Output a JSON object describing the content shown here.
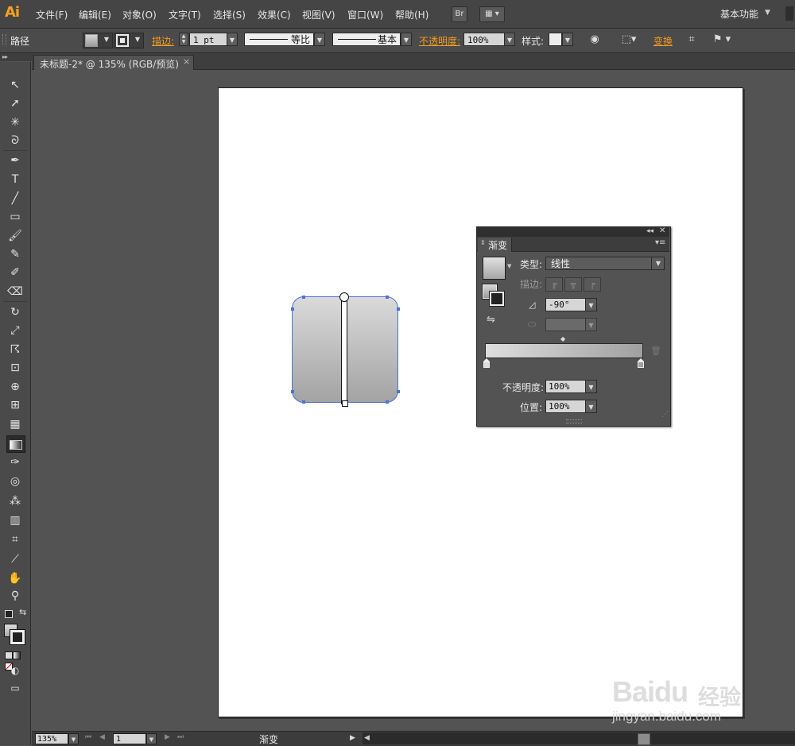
{
  "app": {
    "logo": "Ai"
  },
  "menu": [
    "文件(F)",
    "编辑(E)",
    "对象(O)",
    "文字(T)",
    "选择(S)",
    "效果(C)",
    "视图(V)",
    "窗口(W)",
    "帮助(H)"
  ],
  "menubar_right": {
    "bridge_label": "Br",
    "workspace": "基本功能"
  },
  "control": {
    "object_type": "路径",
    "stroke_link": "描边:",
    "stroke_weight": "1 pt",
    "profile_label": "等比",
    "brush_label": "基本",
    "opacity_link": "不透明度:",
    "opacity_value": "100%",
    "style_label": "样式:",
    "transform_link": "变换"
  },
  "document": {
    "tab_title": "未标题-2* @ 135% (RGB/预览)",
    "close_glyph": "×"
  },
  "gradient_panel": {
    "tab_label": "渐变",
    "type_label": "类型:",
    "type_value": "线性",
    "stroke_label": "描边:",
    "angle_value": "-90°",
    "opacity_label": "不透明度:",
    "opacity_value": "100%",
    "location_label": "位置:",
    "location_value": "100%",
    "colors": {
      "stop_start": "#dedede",
      "stop_end": "#a0a0a0"
    }
  },
  "statusbar": {
    "zoom": "135%",
    "page": "1",
    "status_text": "渐变"
  },
  "watermark": {
    "brand": "Baidu",
    "brand_cn": "经验",
    "url": "jingyan.baidu.com"
  },
  "icons": [
    "selection-tool-icon",
    "direct-selection-icon",
    "magic-wand-icon",
    "lasso-icon",
    "pen-icon",
    "type-icon",
    "line-icon",
    "rectangle-icon",
    "paintbrush-icon",
    "pencil-icon",
    "blob-brush-icon",
    "eraser-icon",
    "rotate-icon",
    "scale-icon",
    "warp-icon",
    "free-transform-icon",
    "shape-builder-icon",
    "perspective-grid-icon",
    "mesh-icon",
    "gradient-icon",
    "eyedropper-icon",
    "blend-icon",
    "symbol-sprayer-icon",
    "column-graph-icon",
    "artboard-icon",
    "slice-icon",
    "hand-icon",
    "zoom-icon"
  ]
}
